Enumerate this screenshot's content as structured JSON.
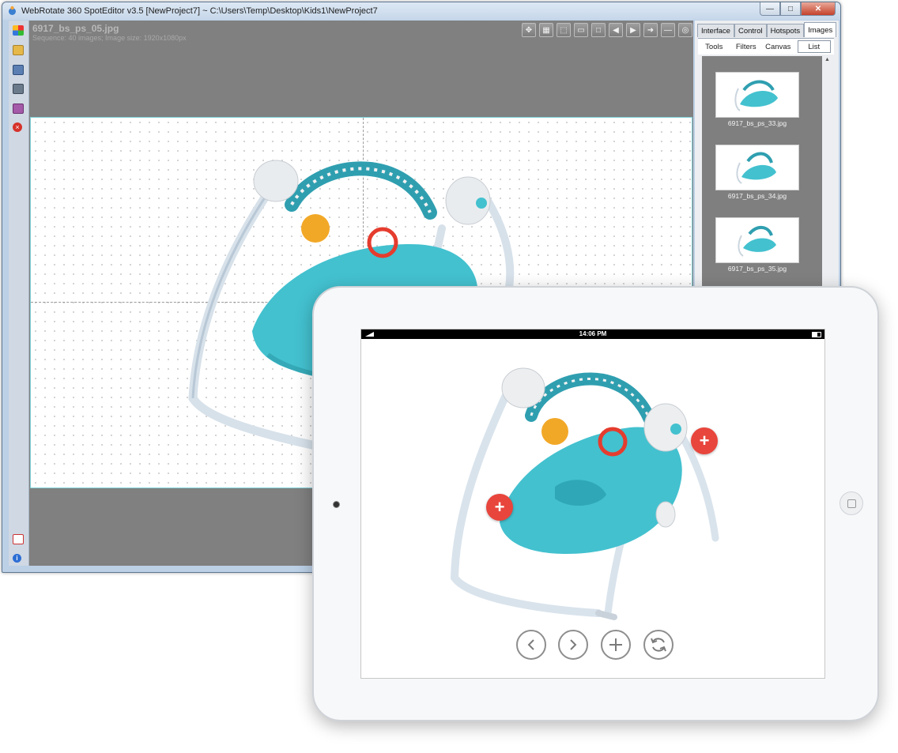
{
  "window": {
    "title": "WebRotate 360 SpotEditor v3.5 [NewProject7] ~ C:\\Users\\Temp\\Desktop\\Kids1\\NewProject7",
    "buttons": {
      "minimize": "—",
      "maximize": "□",
      "close": "✕"
    }
  },
  "editor": {
    "filename": "6917_bs_ps_05.jpg",
    "info": "Sequence: 40 images; Image size: 1920x1080px"
  },
  "panel": {
    "tabs": [
      "Interface",
      "Control",
      "Hotspots",
      "Images"
    ],
    "active_tab": "Images",
    "subtabs": [
      "Tools",
      "Filters",
      "Canvas",
      "List"
    ],
    "active_subtab": "List",
    "thumbnails": [
      "6917_bs_ps_33.jpg",
      "6917_bs_ps_34.jpg",
      "6917_bs_ps_35.jpg"
    ]
  },
  "tablet": {
    "time": "14:06 PM",
    "hotspot_symbol": "+"
  },
  "colors": {
    "hotspot": "#e8453c",
    "selection_border": "#7fd1d8",
    "product_teal": "#43c1cf"
  }
}
